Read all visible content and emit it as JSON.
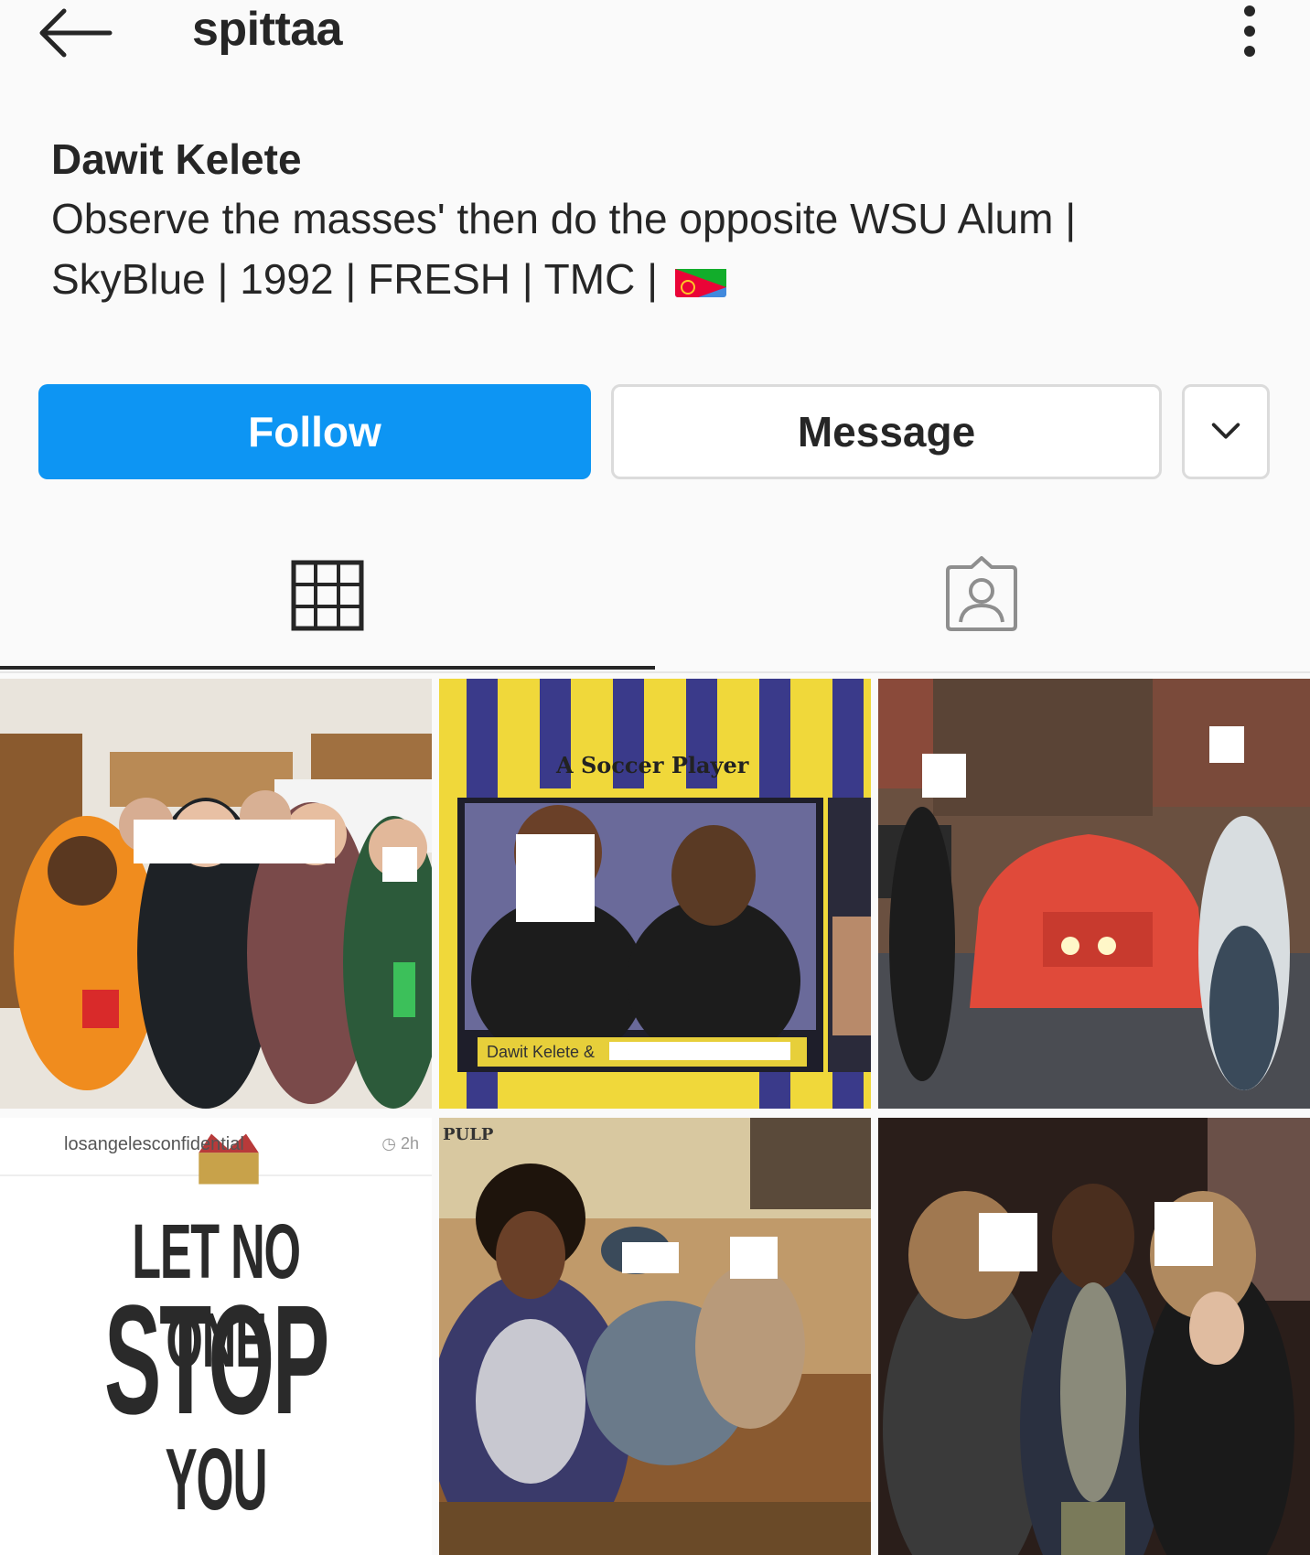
{
  "header": {
    "username": "spittaa",
    "back_icon": "arrow-left-icon",
    "more_icon": "more-vertical-icon"
  },
  "profile": {
    "full_name": "Dawit Kelete",
    "bio_line1": "Observe the masses' then do the opposite WSU Alum |",
    "bio_line2": "SkyBlue | 1992 | FRESH | TMC | ",
    "bio_flag": "eritrea-flag-emoji"
  },
  "actions": {
    "follow_label": "Follow",
    "message_label": "Message",
    "dropdown_icon": "chevron-down-icon",
    "follow_color": "#0d95f3"
  },
  "tabs": {
    "grid_icon": "grid-icon",
    "tagged_icon": "tagged-person-icon",
    "active": "grid"
  },
  "posts": [
    {
      "description": "group-party-photo"
    },
    {
      "description": "yearbook-photo",
      "overlay_text": "A Soccer Player",
      "nameplate": "Dawit Kelete &"
    },
    {
      "description": "car-photo"
    },
    {
      "description": "quote-post",
      "account": "losangelesconfidential",
      "time": "2h",
      "line1": "LET NO ONE",
      "line2": "STOP",
      "line3": "YOU"
    },
    {
      "description": "couch-photo",
      "overlay_text": "PULP"
    },
    {
      "description": "nightclub-photo"
    }
  ]
}
